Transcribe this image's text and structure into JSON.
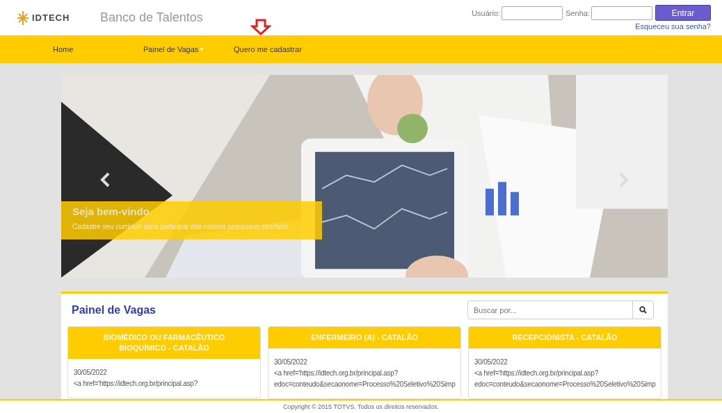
{
  "header": {
    "brand": "IDTECH",
    "title": "Banco de Talentos",
    "login": {
      "user_label": "Usuário:",
      "password_label": "Senha:",
      "submit": "Entrar",
      "forgot": "Esqueceu sua senha?"
    }
  },
  "nav": [
    {
      "label": "Home",
      "has_caret": false
    },
    {
      "label": "Painel de Vagas",
      "has_caret": true
    },
    {
      "label": "Quero me cadastrar",
      "has_caret": false
    }
  ],
  "carousel": {
    "caption_title": "Seja bem-vindo",
    "caption_text": "Cadastre seu currículo para participar dos nossos processos seletivos."
  },
  "panel": {
    "title": "Painel de Vagas",
    "search": {
      "placeholder": "Buscar por..."
    },
    "jobs": [
      {
        "title": "BIOMÉDICO OU FARMACÊUTICO BIOQUÍMICO - CATALÃO",
        "date": "30/05/2022",
        "lines": [
          "<a href='https://idtech.org.br/principal.asp?"
        ]
      },
      {
        "title": "ENFERMEIRO (A) - CATALÃO",
        "date": "30/05/2022",
        "lines": [
          "<a href='https://idtech.org.br/principal.asp?",
          "edoc=conteudo&secaonome=Processo%20Seletivo%20Simp"
        ]
      },
      {
        "title": "RECEPCIONISTA - CATALÃO",
        "date": "30/05/2022",
        "lines": [
          "<a href='https://idtech.org.br/principal.asp?",
          "edoc=conteudo&secaonome=Processo%20Seletivo%20Simp"
        ]
      }
    ]
  },
  "footer": "Copyright © 2015 TOTVS. Todos os direitos reservados."
}
